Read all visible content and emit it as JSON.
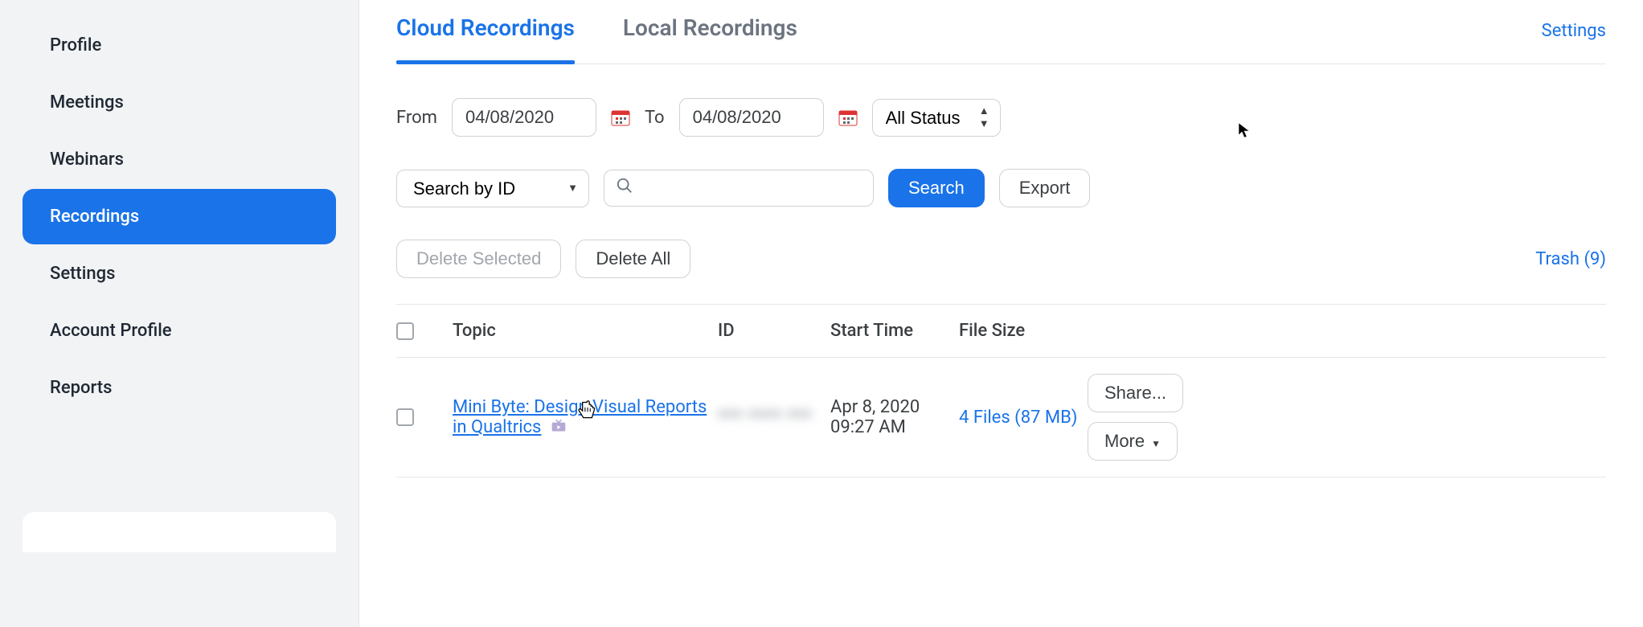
{
  "sidebar": {
    "items": [
      {
        "label": "Profile"
      },
      {
        "label": "Meetings"
      },
      {
        "label": "Webinars"
      },
      {
        "label": "Recordings",
        "active": true
      },
      {
        "label": "Settings"
      },
      {
        "label": "Account Profile"
      },
      {
        "label": "Reports"
      }
    ]
  },
  "tabs": {
    "cloud": "Cloud Recordings",
    "local": "Local Recordings"
  },
  "settings_link": "Settings",
  "filters": {
    "from_label": "From",
    "to_label": "To",
    "from_date": "04/08/2020",
    "to_date": "04/08/2020",
    "status_selected": "All Status"
  },
  "search": {
    "searchby_selected": "Search by ID",
    "input_value": "",
    "search_button": "Search",
    "export_button": "Export"
  },
  "actions": {
    "delete_selected": "Delete Selected",
    "delete_all": "Delete All",
    "trash_label": "Trash (9)"
  },
  "table": {
    "headers": {
      "topic": "Topic",
      "id": "ID",
      "start_time": "Start Time",
      "file_size": "File Size"
    },
    "rows": [
      {
        "topic": "Mini Byte: Design Visual Reports in Qualtrics",
        "id": "*** **** ***",
        "start_time": "Apr 8, 2020 09:27 AM",
        "file_size": "4 Files (87 MB)",
        "share_label": "Share...",
        "more_label": "More"
      }
    ]
  }
}
